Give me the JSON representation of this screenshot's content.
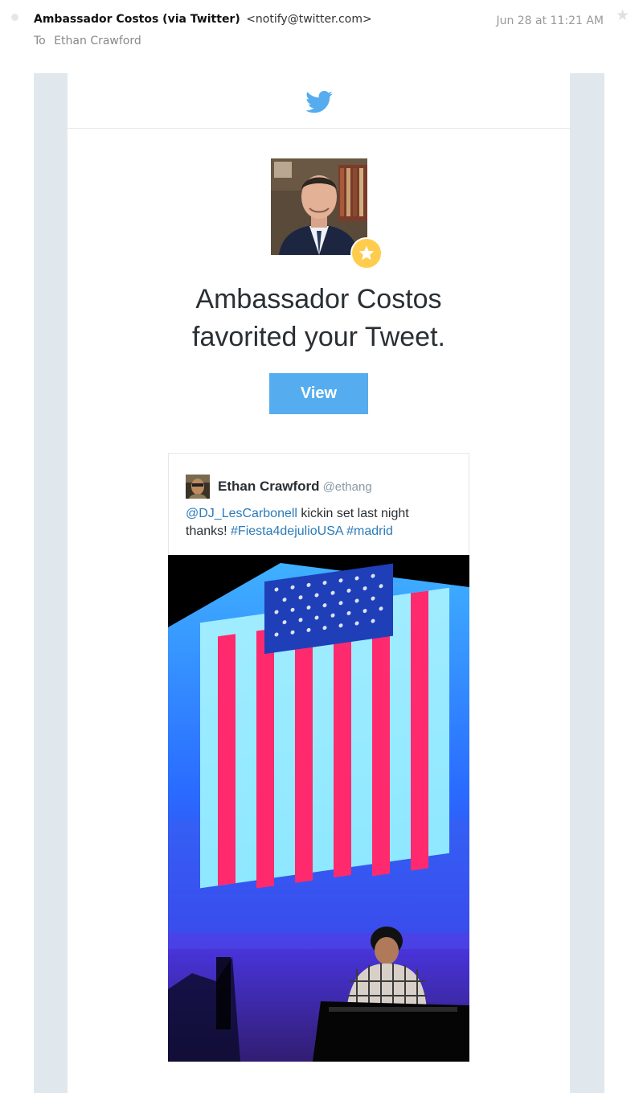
{
  "email": {
    "from_name": "Ambassador Costos (via Twitter)",
    "from_address": "<notify@twitter.com>",
    "to_label": "To",
    "to_name": "Ethan Crawford",
    "date": "Jun 28 at 11:21 AM"
  },
  "notification": {
    "headline_line1": "Ambassador Costos",
    "headline_line2": "favorited your Tweet.",
    "view_button": "View"
  },
  "tweet": {
    "author_name": "Ethan Crawford",
    "author_handle": "@ethang",
    "text_mention": "@DJ_LesCarbonell",
    "text_body": " kickin set last night thanks! ",
    "hashtag_1": "#Fiesta4dejulioUSA",
    "hashtag_2": "#madrid"
  },
  "colors": {
    "twitter_blue": "#55acee",
    "link_blue": "#2b7bb9",
    "favorite_gold": "#ffcc4d",
    "frame_gray": "#e1e8ed"
  },
  "icons": {
    "logo": "twitter-bird-icon",
    "badge": "star-icon",
    "header_star": "star-outline-icon"
  }
}
